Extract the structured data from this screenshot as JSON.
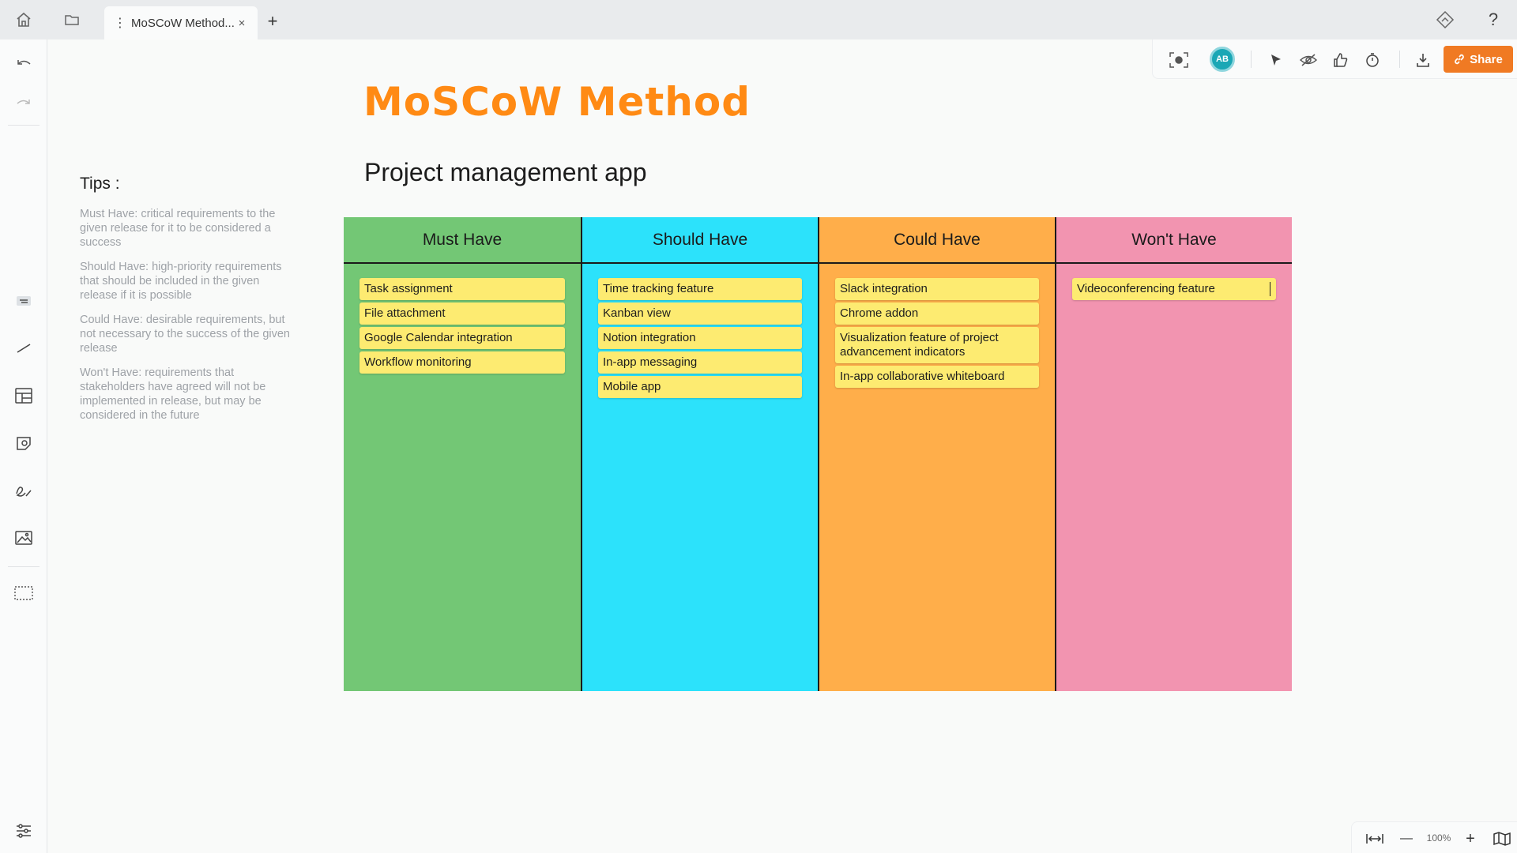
{
  "tabbar": {
    "home_icon": "home-icon",
    "folder_icon": "folder-icon",
    "tab_label": "MoSCoW Method...",
    "tab_close": "×",
    "add_tab": "+",
    "help": "?"
  },
  "toolbar": {
    "avatar_initials": "AB",
    "share_label": "Share",
    "accent_color": "#f07a23"
  },
  "board": {
    "title": "MoSCoW Method",
    "subtitle": "Project management app",
    "columns": [
      {
        "heading": "Must Have",
        "color": "#73c775",
        "notes": [
          "Task assignment",
          "File attachment",
          "Google Calendar integration",
          "Workflow monitoring"
        ]
      },
      {
        "heading": "Should Have",
        "color": "#2ce2fb",
        "notes": [
          "Time tracking feature",
          "Kanban view",
          "Notion integration",
          "In-app messaging",
          "Mobile app"
        ]
      },
      {
        "heading": "Could Have",
        "color": "#ffae4a",
        "notes": [
          "Slack integration",
          "Chrome addon",
          "Visualization feature of project advancement indicators",
          "In-app collaborative whiteboard"
        ]
      },
      {
        "heading": "Won't Have",
        "color": "#f294b0",
        "notes": [
          "Videoconferencing feature"
        ]
      }
    ]
  },
  "tips": {
    "heading": "Tips :",
    "items": [
      "Must Have: critical requirements to the given release for it to be considered a success",
      "Should Have: high-priority requirements that should be included in the given release if it is possible",
      "Could Have: desirable requirements, but not necessary to the success of the given release",
      "Won't Have: requirements that stakeholders have agreed will not be implemented in release, but may be considered in the future"
    ]
  },
  "zoom": {
    "level": "100%",
    "minus": "—",
    "plus": "+"
  }
}
